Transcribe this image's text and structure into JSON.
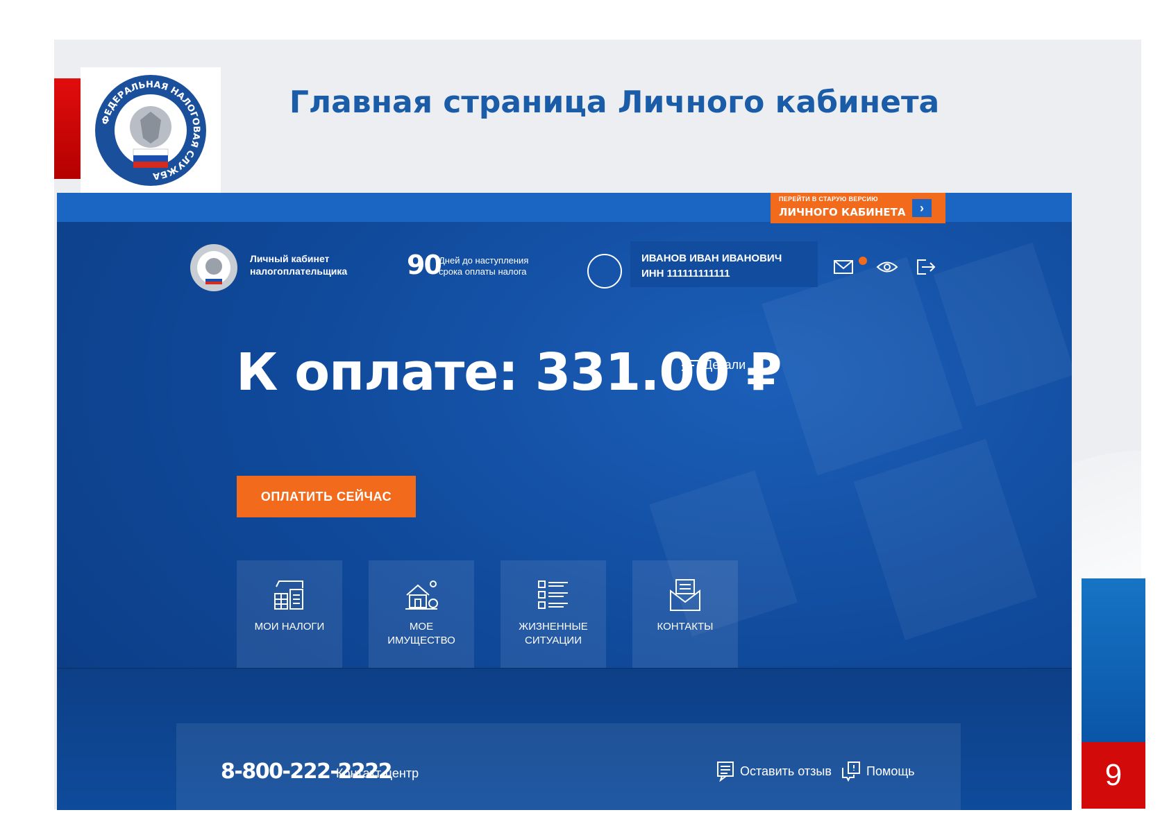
{
  "slide": {
    "title": "Главная страница Личного кабинета",
    "page_number": "9",
    "logo_ring_text": "ФЕДЕРАЛЬНАЯ НАЛОГОВАЯ СЛУЖБА"
  },
  "screen": {
    "old_version": {
      "line1": "ПЕРЕЙТИ В СТАРУЮ ВЕРСИЮ",
      "line2": "ЛИЧНОГО КАБИНЕТА",
      "arrow": "›"
    },
    "header": {
      "cabinet_line1": "Личный кабинет",
      "cabinet_line2": "налогоплательщика",
      "days_number": "90",
      "days_line1": "Дней до наступления",
      "days_line2": "срока оплаты налога",
      "user_name": "ИВАНОВ ИВАН ИВАНОВИЧ",
      "user_inn": "ИНН 111111111111",
      "icons": [
        "mail-icon",
        "eye-icon",
        "logout-icon"
      ]
    },
    "payment": {
      "label": "К оплате: 331.00 ₽",
      "details_label": "Детали",
      "pay_button": "ОПЛАТИТЬ СЕЙЧАС"
    },
    "tiles": [
      {
        "line1": "МОИ НАЛОГИ",
        "line2": "",
        "icon": "taxes-icon"
      },
      {
        "line1": "МОЕ",
        "line2": "ИМУЩЕСТВО",
        "icon": "property-icon"
      },
      {
        "line1": "ЖИЗНЕННЫЕ",
        "line2": "СИТУАЦИИ",
        "icon": "list-icon"
      },
      {
        "line1": "КОНТАКТЫ",
        "line2": "",
        "icon": "envelope-icon"
      }
    ],
    "footer": {
      "phone": "8-800-222-2222",
      "phone_label": "Контакт-центр",
      "feedback_label": "Оставить отзыв",
      "help_label": "Помощь"
    }
  },
  "colors": {
    "title_blue": "#1a5ca8",
    "screen_blue": "#104a9c",
    "accent_orange": "#f26a1b",
    "slide_red": "#d20a0a"
  }
}
